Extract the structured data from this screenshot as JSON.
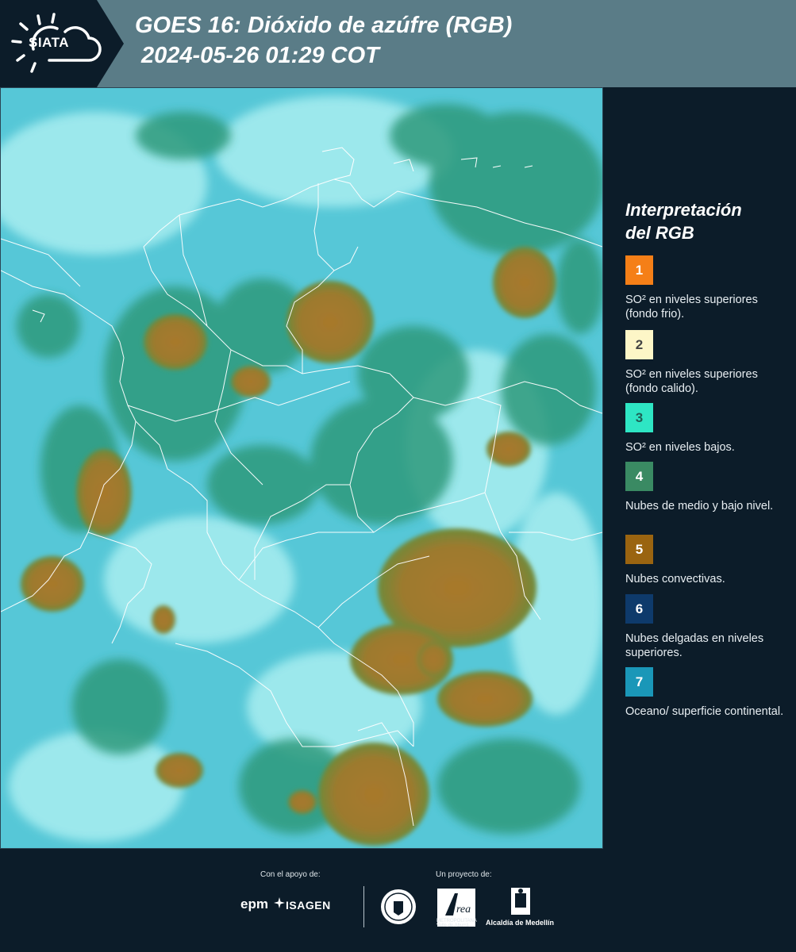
{
  "header": {
    "logo_text": "SIATA",
    "title_line1": "GOES 16: Dióxido de azúfre (RGB)",
    "title_line2": "2024-05-26 01:29 COT"
  },
  "legend": {
    "title_line1": "Interpretación",
    "title_line2": "del RGB",
    "items": [
      {
        "number": "1",
        "color": "#f57f17",
        "number_color": "#ffffff",
        "description": "SO² en niveles superiores (fondo frio)."
      },
      {
        "number": "2",
        "color": "#fdf6c7",
        "number_color": "#444444",
        "description": "SO² en niveles superiores (fondo calido)."
      },
      {
        "number": "3",
        "color": "#2ee6c4",
        "number_color": "#1f5f55",
        "description": "SO² en niveles bajos."
      },
      {
        "number": "4",
        "color": "#3a8a63",
        "number_color": "#ffffff",
        "description": "Nubes de medio y bajo nivel."
      },
      {
        "number": "5",
        "color": "#9a6410",
        "number_color": "#ffffff",
        "description": "Nubes convectivas."
      },
      {
        "number": "6",
        "color": "#0e3a6b",
        "number_color": "#ffffff",
        "description": "Nubes delgadas en niveles superiores."
      },
      {
        "number": "7",
        "color": "#1a97b8",
        "number_color": "#ffffff",
        "description": "Oceano/ superficie continental."
      }
    ]
  },
  "footer": {
    "support_label": "Con el apoyo de:",
    "project_label": "Un proyecto de:",
    "sponsor1": "epm",
    "sponsor2": "ISAGEN",
    "area_text": "METROPOLITANA Valle de Aburrá",
    "alcaldia": "Alcaldía de Medellín"
  },
  "map": {
    "colors": {
      "background": "#56c7d7",
      "cloud_light": "#aef0f2",
      "low_cloud": "#2f9a7c",
      "low_cloud_dark": "#1e7a5a",
      "convective": "#a67a2a",
      "convective_edge": "#7a7a2a",
      "borders": "#ffffff"
    }
  }
}
